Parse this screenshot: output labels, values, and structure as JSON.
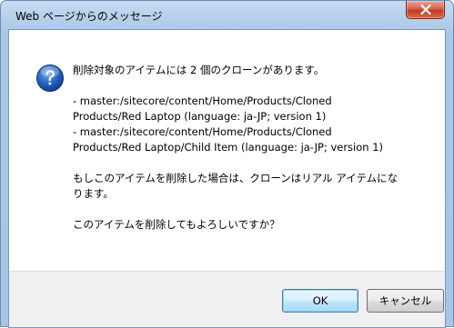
{
  "dialog": {
    "title": "Web ページからのメッセージ",
    "icon": "question-icon",
    "message": {
      "line1": "削除対象のアイテムには 2 個のクローンがあります。",
      "line2": "- master:/sitecore/content/Home/Products/Cloned",
      "line3": "Products/Red Laptop (language: ja-JP; version 1)",
      "line4": "- master:/sitecore/content/Home/Products/Cloned",
      "line5": "Products/Red Laptop/Child Item (language: ja-JP; version 1)",
      "line6": "もしこのアイテムを削除した場合は、クローンはリアル アイテムにな",
      "line7": "ります。",
      "line8": "このアイテムを削除してもよろしいですか？"
    },
    "buttons": {
      "ok_label": "OK",
      "cancel_label": "キャンセル"
    }
  },
  "colors": {
    "frame": "#a9c6e6",
    "close_button": "#c33b22",
    "footer": "#f0f0f0",
    "ok_border": "#3c7fb1"
  }
}
